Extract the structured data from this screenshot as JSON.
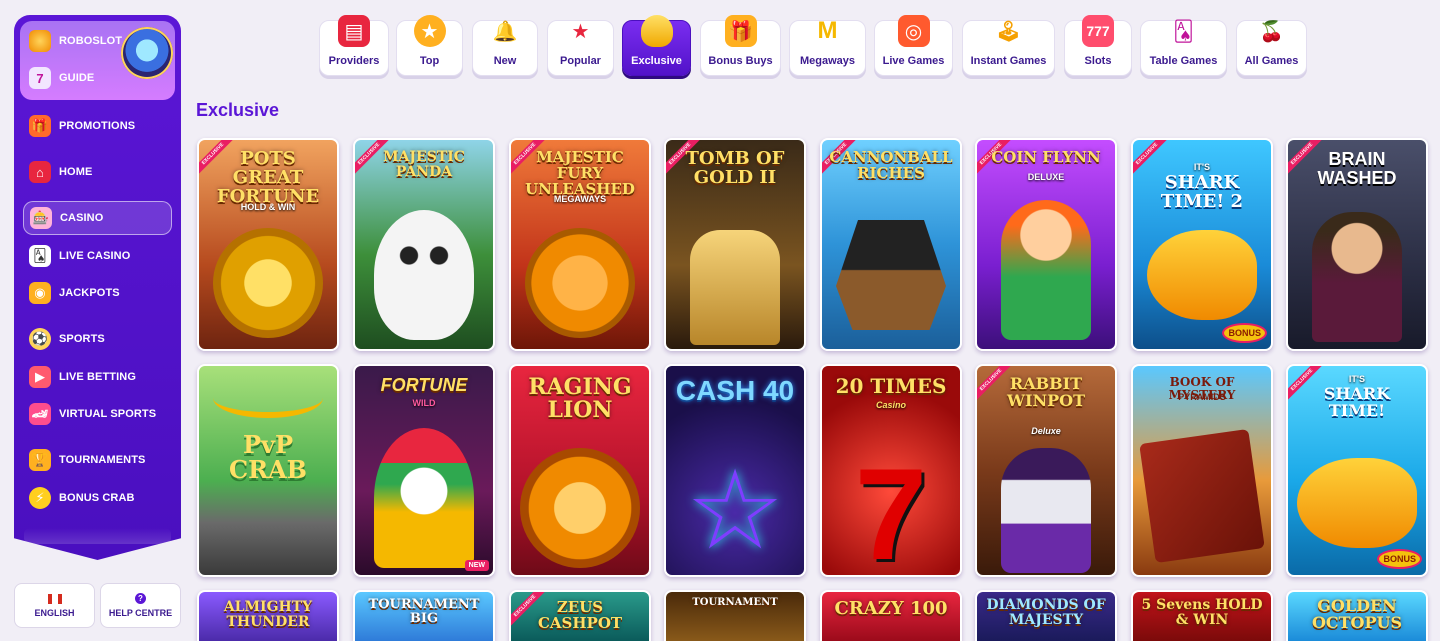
{
  "sidebar": {
    "top": [
      {
        "label": "ROBOSLOT",
        "icon": "coin-icon"
      },
      {
        "label": "GUIDE",
        "icon": "slot-machine-icon"
      }
    ],
    "items": [
      {
        "label": "PROMOTIONS",
        "icon": "gift-icon"
      },
      {
        "label": "HOME",
        "icon": "home-icon"
      },
      {
        "label": "CASINO",
        "icon": "casino-icon",
        "active": true
      },
      {
        "label": "LIVE CASINO",
        "icon": "cards-icon"
      },
      {
        "label": "JACKPOTS",
        "icon": "coins-icon"
      },
      {
        "label": "SPORTS",
        "icon": "soccer-ball-icon"
      },
      {
        "label": "LIVE BETTING",
        "icon": "live-tv-icon"
      },
      {
        "label": "VIRTUAL SPORTS",
        "icon": "virtual-sports-icon"
      },
      {
        "label": "TOURNAMENTS",
        "icon": "trophy-icon"
      },
      {
        "label": "BONUS CRAB",
        "icon": "lightning-coin-icon"
      }
    ]
  },
  "footer_buttons": {
    "language": "ENGLISH",
    "help": "HELP CENTRE"
  },
  "categories": [
    {
      "label": "Providers",
      "icon": "providers-icon"
    },
    {
      "label": "Top",
      "icon": "medal-icon"
    },
    {
      "label": "New",
      "icon": "bell-icon"
    },
    {
      "label": "Popular",
      "icon": "star-icon"
    },
    {
      "label": "Exclusive",
      "icon": "gold-bar-icon",
      "active": true
    },
    {
      "label": "Bonus Buys",
      "icon": "gift-box-icon"
    },
    {
      "label": "Megaways",
      "icon": "megaways-icon"
    },
    {
      "label": "Live Games",
      "icon": "live-camera-icon"
    },
    {
      "label": "Instant Games",
      "icon": "joystick-icon"
    },
    {
      "label": "Slots",
      "icon": "slot-reels-icon"
    },
    {
      "label": "Table Games",
      "icon": "table-chips-icon"
    },
    {
      "label": "All Games",
      "icon": "cherries-icon"
    }
  ],
  "section_title": "Exclusive",
  "ribbon_text": "EXCLUSIVE",
  "new_badge": "NEW",
  "bonus_badge": "BONUS",
  "games_row1": [
    {
      "title": "POTS GREAT FORTUNE",
      "sub": "HOLD & WIN",
      "exclusive": true
    },
    {
      "title": "MAJESTIC PANDA",
      "sub": "",
      "exclusive": true
    },
    {
      "title": "MAJESTIC FURY UNLEASHED",
      "sub": "MEGAWAYS",
      "exclusive": true
    },
    {
      "title": "TOMB OF GOLD II",
      "sub": "",
      "exclusive": true
    },
    {
      "title": "CANNONBALL RICHES",
      "sub": "",
      "exclusive": true
    },
    {
      "title": "COIN FLYNN",
      "sub": "DELUXE",
      "exclusive": true
    },
    {
      "title": "SHARK TIME! 2",
      "sub": "IT'S",
      "exclusive": true
    },
    {
      "title": "BRAIN WASHED",
      "sub": "",
      "exclusive": true
    }
  ],
  "games_row2": [
    {
      "title": "PvP CRAB",
      "sub": "",
      "exclusive": false
    },
    {
      "title": "FORTUNE",
      "sub": "WILD",
      "exclusive": false
    },
    {
      "title": "RAGING LION",
      "sub": "",
      "exclusive": false
    },
    {
      "title": "CASH 40",
      "sub": "",
      "exclusive": false
    },
    {
      "title": "20 TIMES",
      "sub": "Casino",
      "exclusive": false
    },
    {
      "title": "RABBIT WINPOT",
      "sub": "Deluxe",
      "exclusive": true
    },
    {
      "title": "BOOK OF MYSTERY",
      "sub": "PYRAMIDS",
      "exclusive": false
    },
    {
      "title": "SHARK TIME!",
      "sub": "IT'S",
      "exclusive": true
    }
  ],
  "games_row3": [
    {
      "title": "ALMIGHTY THUNDER"
    },
    {
      "title": "TOURNAMENT BIG"
    },
    {
      "title": "ZEUS CASHPOT"
    },
    {
      "title": "TOURNAMENT"
    },
    {
      "title": "CRAZY 100"
    },
    {
      "title": "DIAMONDS OF MAJESTY"
    },
    {
      "title": "5 Sevens HOLD & WIN"
    },
    {
      "title": "GOLDEN OCTOPUS"
    }
  ]
}
